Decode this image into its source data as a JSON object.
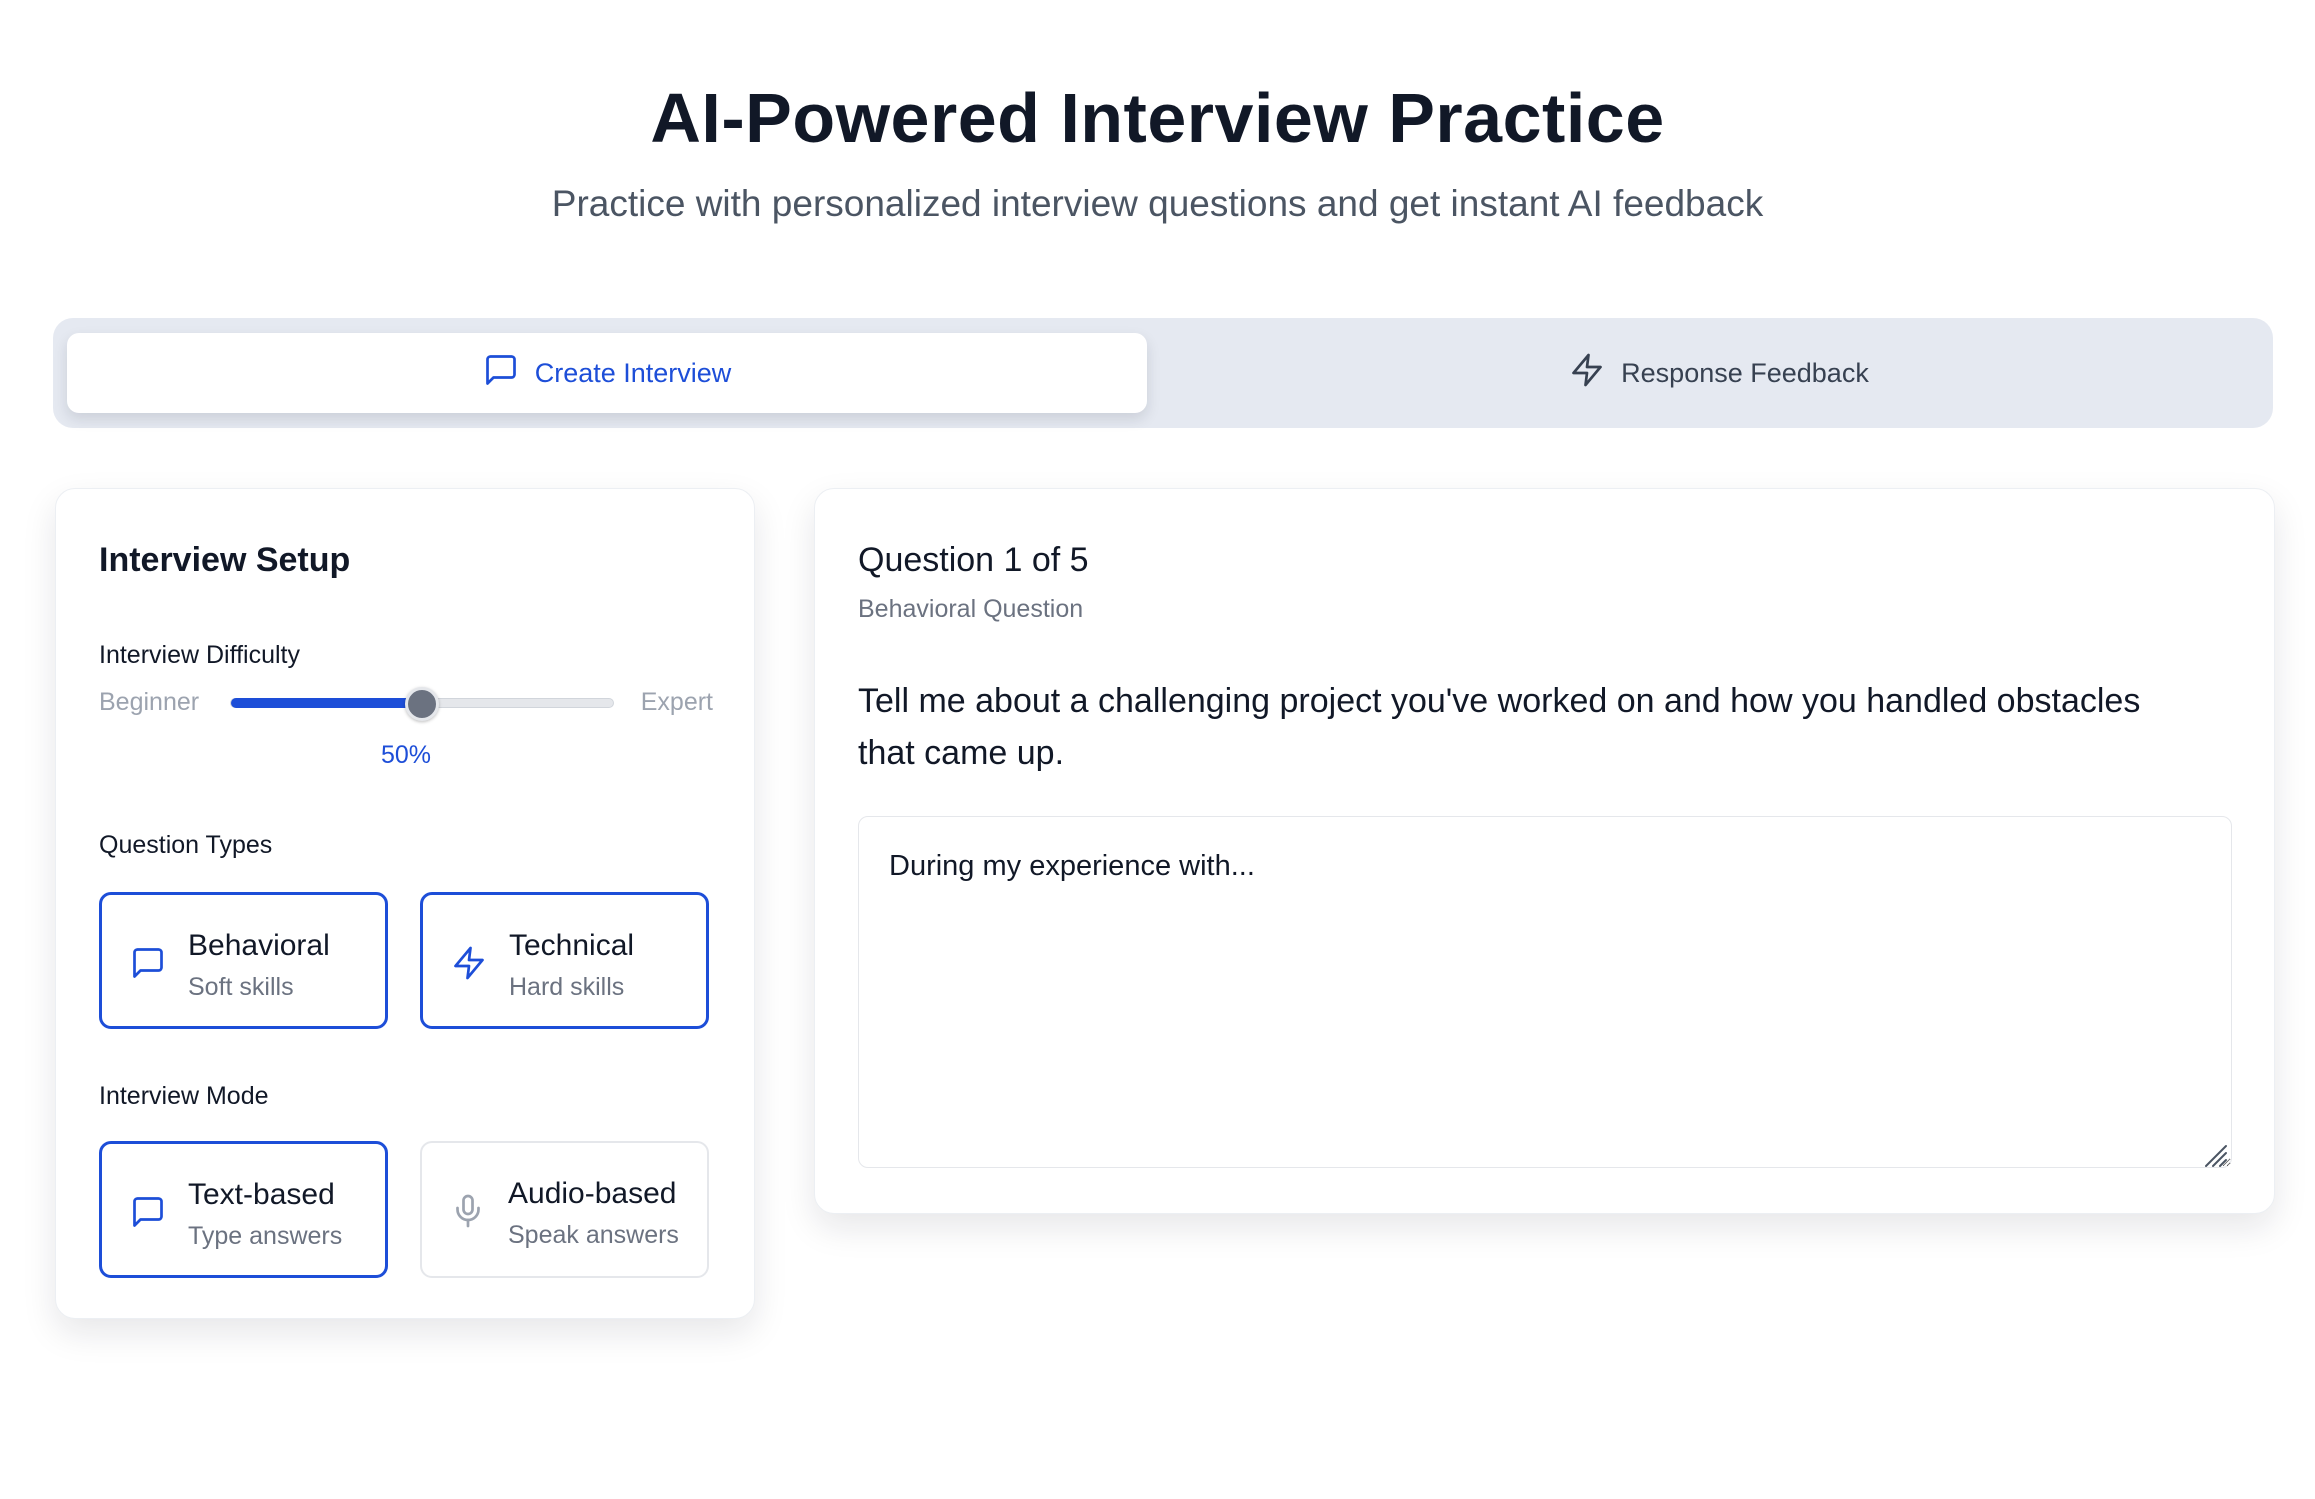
{
  "header": {
    "title": "AI-Powered Interview Practice",
    "subtitle": "Practice with personalized interview questions and get instant AI feedback"
  },
  "tabs": [
    {
      "label": "Create Interview",
      "icon": "message-square-icon",
      "active": true
    },
    {
      "label": "Response Feedback",
      "icon": "lightning-icon",
      "active": false
    }
  ],
  "setup": {
    "title": "Interview Setup",
    "difficulty": {
      "label": "Interview Difficulty",
      "min_label": "Beginner",
      "max_label": "Expert",
      "value_text": "50%",
      "value": 0.5
    },
    "question_types": {
      "label": "Question Types",
      "options": [
        {
          "title": "Behavioral",
          "subtitle": "Soft skills",
          "icon": "message-square-icon",
          "selected": true
        },
        {
          "title": "Technical",
          "subtitle": "Hard skills",
          "icon": "lightning-icon",
          "selected": true
        }
      ]
    },
    "mode": {
      "label": "Interview Mode",
      "options": [
        {
          "title": "Text-based",
          "subtitle": "Type answers",
          "icon": "message-square-icon",
          "selected": true
        },
        {
          "title": "Audio-based",
          "subtitle": "Speak answers",
          "icon": "microphone-icon",
          "selected": false
        }
      ]
    }
  },
  "question": {
    "counter": "Question 1 of 5",
    "type": "Behavioral Question",
    "text": "Tell me about a challenging project you've worked on and how you handled obstacles that came up.",
    "answer_value": "During my experience with..."
  },
  "colors": {
    "accent": "#1d4ed8",
    "tab_bar_bg": "#e5e9f1",
    "muted_text": "#6b7280"
  }
}
